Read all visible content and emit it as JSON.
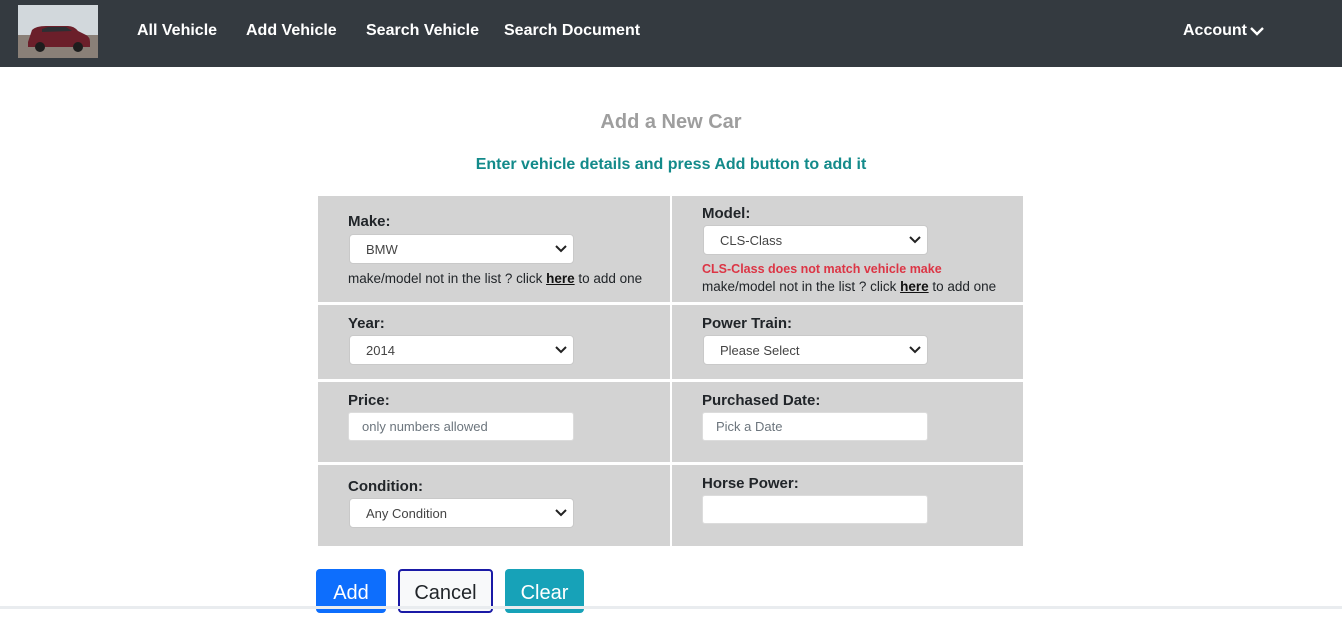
{
  "nav": {
    "items": [
      "All Vehicle",
      "Add Vehicle",
      "Search Vehicle",
      "Search Document"
    ],
    "account_label": "Account"
  },
  "header": {
    "title": "Add a New Car",
    "subtitle": "Enter vehicle details and press Add button to add it"
  },
  "form": {
    "make": {
      "label": "Make:",
      "value": "BMW"
    },
    "model": {
      "label": "Model:",
      "value": "CLS-Class",
      "error": "CLS-Class does not match vehicle make"
    },
    "help": {
      "prefix": "make/model not in the list ? click ",
      "link": "here",
      "suffix": " to add one"
    },
    "year": {
      "label": "Year:",
      "value": "2014"
    },
    "power_train": {
      "label": "Power Train:",
      "value": "Please Select"
    },
    "price": {
      "label": "Price:",
      "placeholder": "only numbers allowed"
    },
    "purchased_date": {
      "label": "Purchased Date:",
      "placeholder": "Pick a Date"
    },
    "condition": {
      "label": "Condition:",
      "value": "Any Condition"
    },
    "horse_power": {
      "label": "Horse Power:",
      "value": ""
    }
  },
  "buttons": {
    "add": "Add",
    "cancel": "Cancel",
    "clear": "Clear"
  },
  "colors": {
    "navbar": "#343a40",
    "title": "#9e9e9e",
    "subtitle": "#138a8a",
    "cell_bg": "#d3d3d3",
    "error": "#dc3545",
    "add_button": "#0d6efd",
    "clear_button": "#17a2b8"
  },
  "icons": {
    "account_chevron": "chevron-down-icon",
    "select_chevron": "chevron-down-icon"
  }
}
